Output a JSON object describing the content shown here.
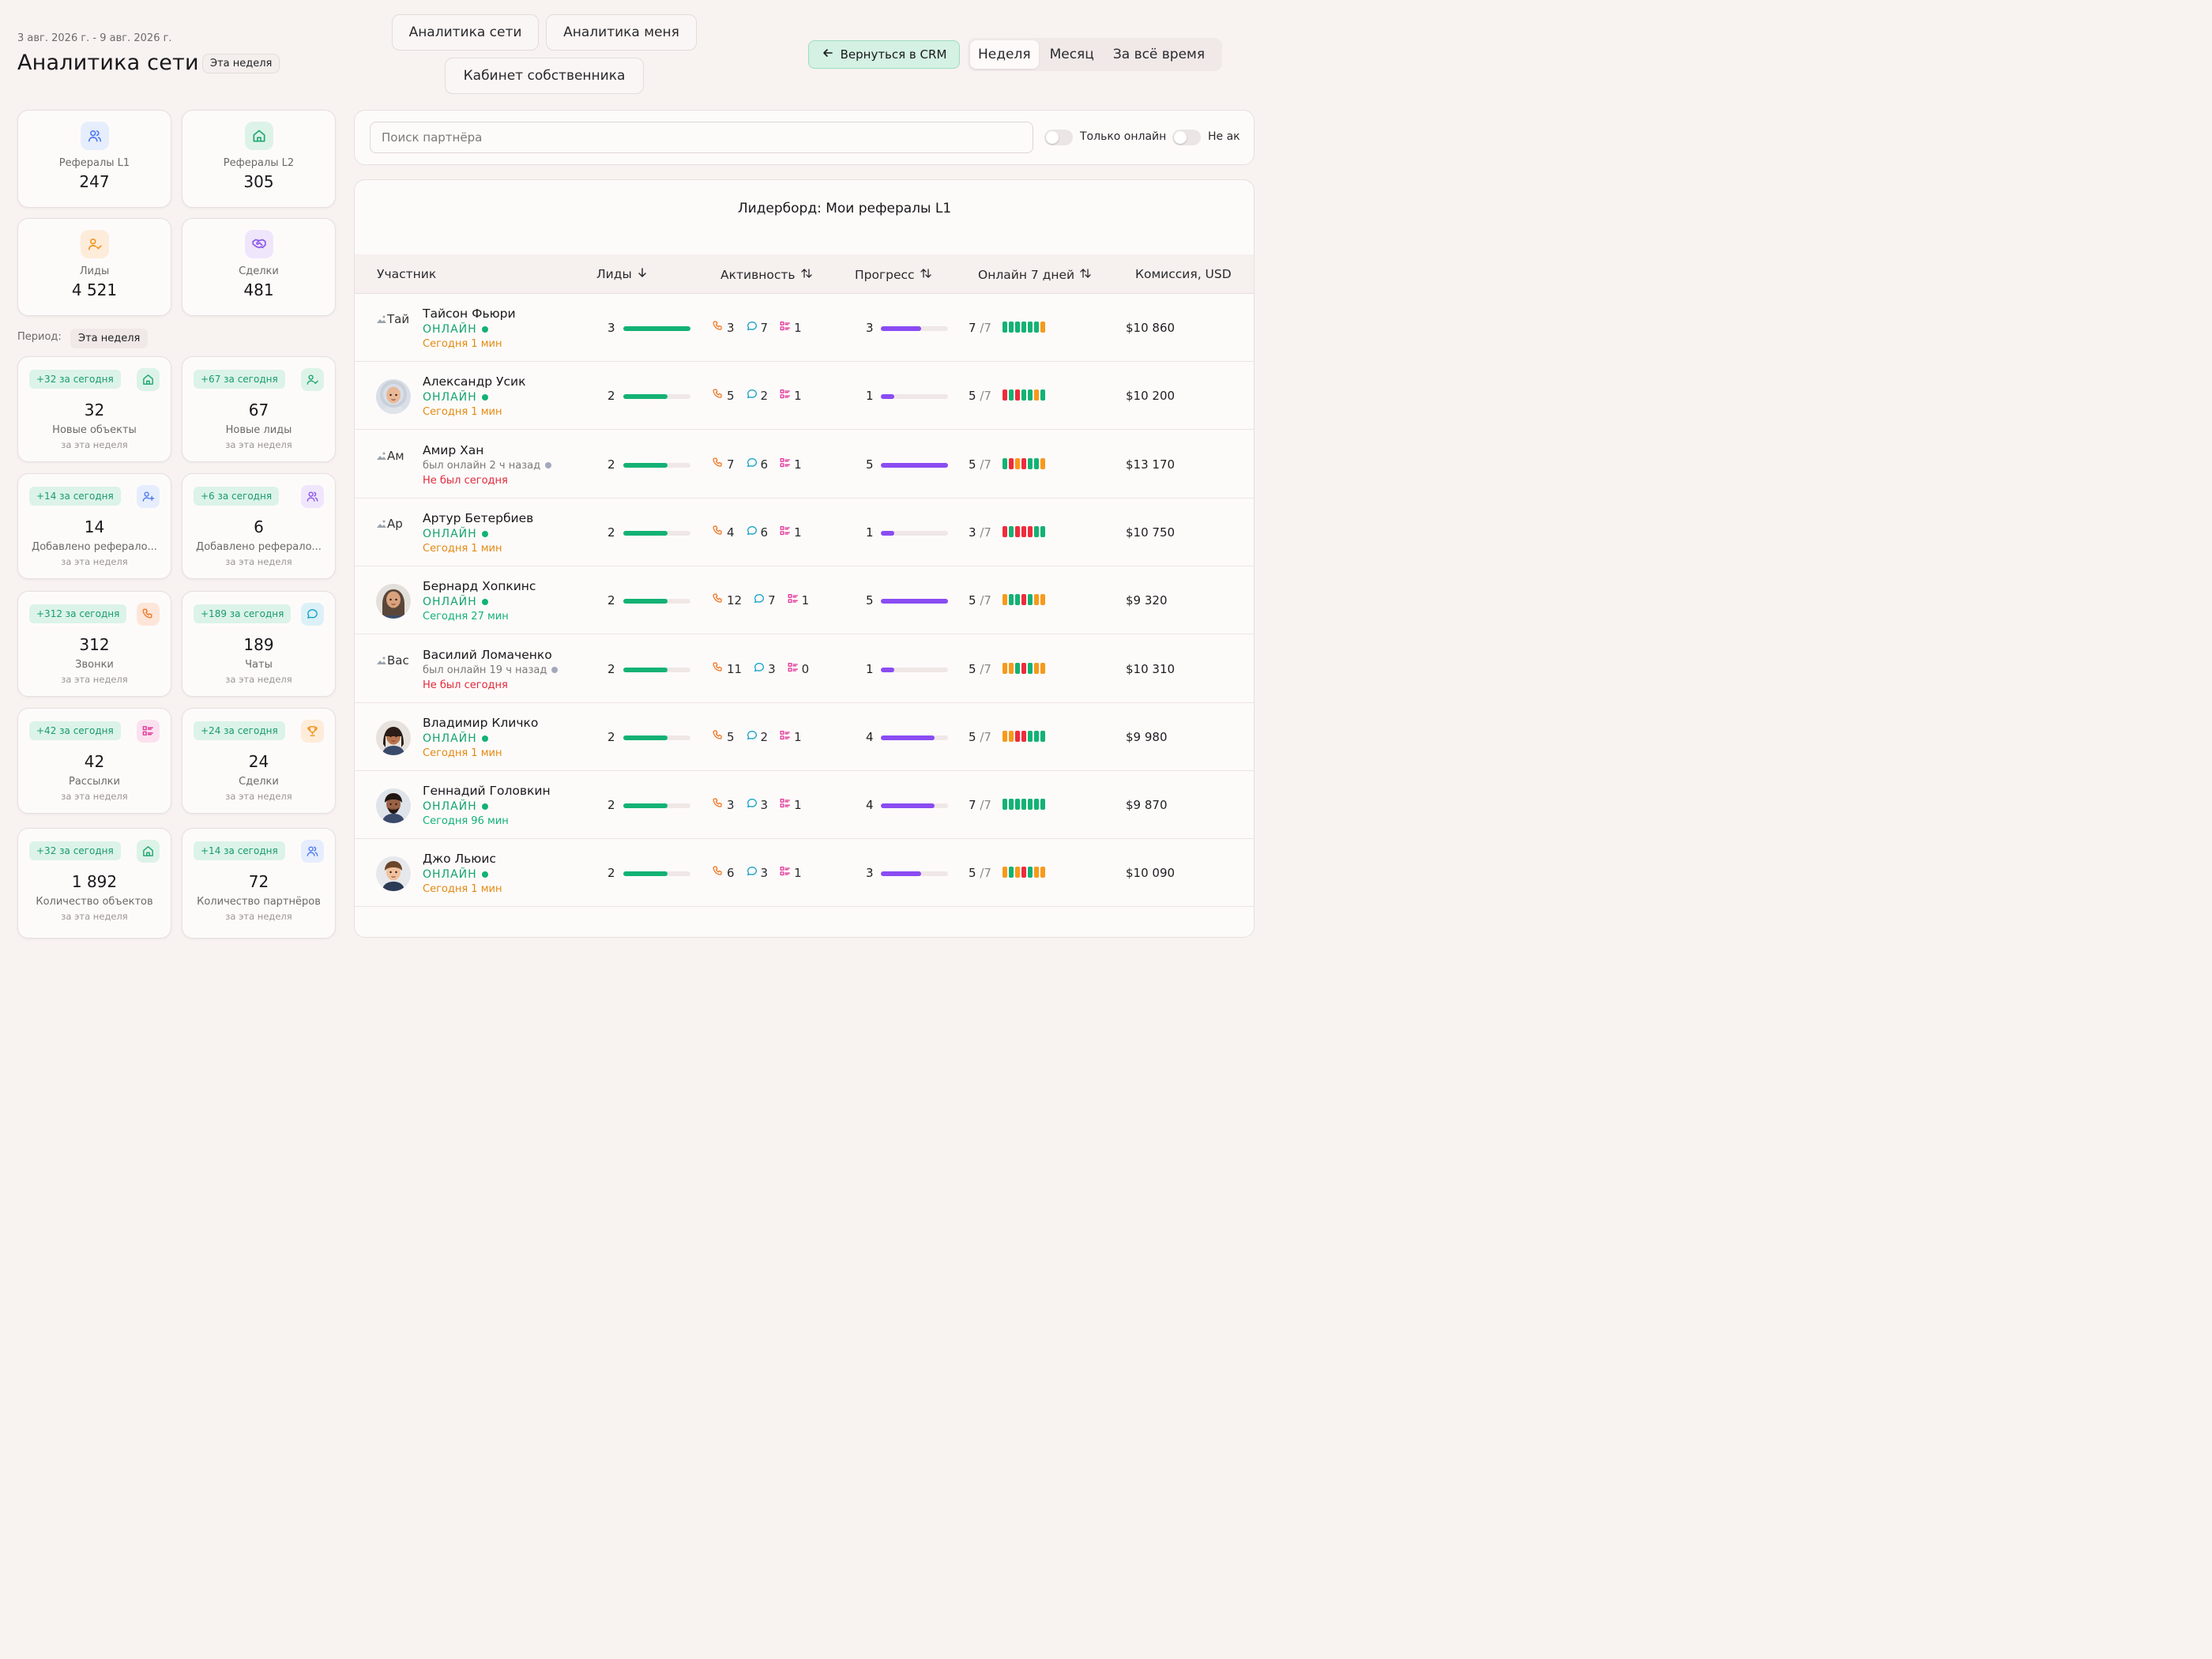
{
  "header": {
    "date_range": "3 авг. 2026 г. - 9 авг. 2026 г.",
    "title": "Аналитика сети",
    "title_badge": "Эта неделя",
    "nav": [
      "Аналитика сети",
      "Аналитика меня",
      "Кабинет собственника"
    ],
    "crm_button": "Вернуться в CRM",
    "periods": [
      "Неделя",
      "Месяц",
      "За всё время"
    ],
    "active_period": "Неделя"
  },
  "summary": [
    {
      "label": "Рефералы L1",
      "value": "247",
      "icon": "users-icon",
      "color": "#4f7cf0",
      "bg": "#e6edfd"
    },
    {
      "label": "Рефералы L2",
      "value": "305",
      "icon": "home-icon",
      "color": "#1fa66f",
      "bg": "#ddf3e8"
    },
    {
      "label": "Лиды",
      "value": "4 521",
      "icon": "user-check-icon",
      "color": "#f0941e",
      "bg": "#fdecd9"
    },
    {
      "label": "Сделки",
      "value": "481",
      "icon": "handshake-icon",
      "color": "#8b56e8",
      "bg": "#efe6fc"
    }
  ],
  "period": {
    "label": "Период:",
    "value": "Эта неделя"
  },
  "metrics": [
    {
      "today": "+32 за сегодня",
      "value": "32",
      "label": "Новые объекты",
      "sub": "за эта неделя",
      "icon": "home-icon",
      "color": "#1fa66f",
      "bg": "#ddf3e8"
    },
    {
      "today": "+67 за сегодня",
      "value": "67",
      "label": "Новые лиды",
      "sub": "за эта неделя",
      "icon": "user-check-icon",
      "color": "#1fa66f",
      "bg": "#ddf3e8"
    },
    {
      "today": "+14 за сегодня",
      "value": "14",
      "label": "Добавлено реферало...",
      "sub": "за эта неделя",
      "icon": "user-plus-icon",
      "color": "#4f7cf0",
      "bg": "#e6edfd"
    },
    {
      "today": "+6 за сегодня",
      "value": "6",
      "label": "Добавлено реферало...",
      "sub": "за эта неделя",
      "icon": "users-icon",
      "color": "#8b56e8",
      "bg": "#efe6fc"
    },
    {
      "today": "+312 за сегодня",
      "value": "312",
      "label": "Звонки",
      "sub": "за эта неделя",
      "icon": "phone-icon",
      "color": "#f07b2a",
      "bg": "#fde6d9"
    },
    {
      "today": "+189 за сегодня",
      "value": "189",
      "label": "Чаты",
      "sub": "за эта неделя",
      "icon": "chat-icon",
      "color": "#1aa3c8",
      "bg": "#dcf1f7"
    },
    {
      "today": "+42 за сегодня",
      "value": "42",
      "label": "Рассылки",
      "sub": "за эта неделя",
      "icon": "list-icon",
      "color": "#e23a9a",
      "bg": "#fbe1ef"
    },
    {
      "today": "+24 за сегодня",
      "value": "24",
      "label": "Сделки",
      "sub": "за эта неделя",
      "icon": "trophy-icon",
      "color": "#f0941e",
      "bg": "#fdecd9"
    },
    {
      "today": "+32 за сегодня",
      "value": "1 892",
      "label": "Количество объектов",
      "sub": "за эта неделя",
      "icon": "home-icon",
      "color": "#1fa66f",
      "bg": "#ddf3e8"
    },
    {
      "today": "+14 за сегодня",
      "value": "72",
      "label": "Количество партнёров",
      "sub": "за эта неделя",
      "icon": "users-icon",
      "color": "#4f7cf0",
      "bg": "#e6edfd"
    }
  ],
  "search": {
    "placeholder": "Поиск партнёра",
    "toggle_online": "Только онлайн",
    "toggle_inactive": "Не ак"
  },
  "leaderboard": {
    "title": "Лидерборд: Мои рефералы L1",
    "columns": [
      "Участник",
      "Лиды",
      "Активность",
      "Прогресс",
      "Онлайн 7 дней",
      "Комиссия, USD"
    ],
    "rows": [
      {
        "name": "Тайсон Фьюри",
        "avatar_alt": "Тай",
        "status": "ОНЛАЙН",
        "online": true,
        "last": "Сегодня 1 мин",
        "last_ok": true,
        "leads": "3",
        "leads_frac": 1.0,
        "calls": "3",
        "chats": "7",
        "mails": "1",
        "progress": "3",
        "progress_frac": 0.6,
        "days": "7",
        "days_total": "/7",
        "segs": [
          "g",
          "g",
          "g",
          "g",
          "g",
          "g",
          "o"
        ],
        "commission": "$10 860"
      },
      {
        "name": "Александр Усик",
        "avatar_alt": "",
        "status": "ОНЛАЙН",
        "online": true,
        "last": "Сегодня 1 мин",
        "last_ok": true,
        "leads": "2",
        "leads_frac": 0.66,
        "calls": "5",
        "chats": "2",
        "mails": "1",
        "progress": "1",
        "progress_frac": 0.2,
        "days": "5",
        "days_total": "/7",
        "segs": [
          "r",
          "g",
          "r",
          "g",
          "g",
          "o",
          "g"
        ],
        "commission": "$10 200"
      },
      {
        "name": "Амир Хан",
        "avatar_alt": "Ам",
        "status": "был онлайн 2 ч назад",
        "online": false,
        "last": "Не был сегодня",
        "last_ok": false,
        "leads": "2",
        "leads_frac": 0.66,
        "calls": "7",
        "chats": "6",
        "mails": "1",
        "progress": "5",
        "progress_frac": 1.0,
        "days": "5",
        "days_total": "/7",
        "segs": [
          "g",
          "r",
          "o",
          "r",
          "g",
          "g",
          "o"
        ],
        "commission": "$13 170"
      },
      {
        "name": "Артур Бетербиев",
        "avatar_alt": "Ар",
        "status": "ОНЛАЙН",
        "online": true,
        "last": "Сегодня 1 мин",
        "last_ok": true,
        "leads": "2",
        "leads_frac": 0.66,
        "calls": "4",
        "chats": "6",
        "mails": "1",
        "progress": "1",
        "progress_frac": 0.2,
        "days": "3",
        "days_total": "/7",
        "segs": [
          "r",
          "g",
          "r",
          "r",
          "r",
          "g",
          "g"
        ],
        "commission": "$10 750"
      },
      {
        "name": "Бернард Хопкинс",
        "avatar_alt": "",
        "status": "ОНЛАЙН",
        "online": true,
        "last": "Сегодня 27 мин",
        "last_ok": false,
        "last_green": true,
        "leads": "2",
        "leads_frac": 0.66,
        "calls": "12",
        "chats": "7",
        "mails": "1",
        "progress": "5",
        "progress_frac": 1.0,
        "days": "5",
        "days_total": "/7",
        "segs": [
          "o",
          "g",
          "g",
          "r",
          "g",
          "o",
          "o"
        ],
        "commission": "$9 320"
      },
      {
        "name": "Василий Ломаченко",
        "avatar_alt": "Вас",
        "status": "был онлайн 19 ч назад",
        "online": false,
        "last": "Не был сегодня",
        "last_ok": false,
        "leads": "2",
        "leads_frac": 0.66,
        "calls": "11",
        "chats": "3",
        "mails": "0",
        "progress": "1",
        "progress_frac": 0.2,
        "days": "5",
        "days_total": "/7",
        "segs": [
          "o",
          "o",
          "g",
          "r",
          "g",
          "o",
          "o"
        ],
        "commission": "$10 310"
      },
      {
        "name": "Владимир Кличко",
        "avatar_alt": "",
        "status": "ОНЛАЙН",
        "online": true,
        "last": "Сегодня 1 мин",
        "last_ok": true,
        "leads": "2",
        "leads_frac": 0.66,
        "calls": "5",
        "chats": "2",
        "mails": "1",
        "progress": "4",
        "progress_frac": 0.8,
        "days": "5",
        "days_total": "/7",
        "segs": [
          "o",
          "o",
          "r",
          "r",
          "g",
          "g",
          "g"
        ],
        "commission": "$9 980"
      },
      {
        "name": "Геннадий Головкин",
        "avatar_alt": "",
        "status": "ОНЛАЙН",
        "online": true,
        "last": "Сегодня 96 мин",
        "last_ok": false,
        "last_green": true,
        "leads": "2",
        "leads_frac": 0.66,
        "calls": "3",
        "chats": "3",
        "mails": "1",
        "progress": "4",
        "progress_frac": 0.8,
        "days": "7",
        "days_total": "/7",
        "segs": [
          "g",
          "g",
          "g",
          "g",
          "g",
          "g",
          "g"
        ],
        "commission": "$9 870"
      },
      {
        "name": "Джо Льюис",
        "avatar_alt": "",
        "status": "ОНЛАЙН",
        "online": true,
        "last": "Сегодня 1 мин",
        "last_ok": true,
        "leads": "2",
        "leads_frac": 0.66,
        "calls": "6",
        "chats": "3",
        "mails": "1",
        "progress": "3",
        "progress_frac": 0.6,
        "days": "5",
        "days_total": "/7",
        "segs": [
          "o",
          "g",
          "o",
          "r",
          "g",
          "o",
          "o"
        ],
        "commission": "$10 090"
      }
    ]
  },
  "colors": {
    "green": "#13b274",
    "red": "#ee2c3c",
    "orange": "#f79a1b",
    "purple": "#8a4cf2",
    "phone": "#f07b2a",
    "chat": "#1aa3c8",
    "list": "#e23a9a"
  }
}
